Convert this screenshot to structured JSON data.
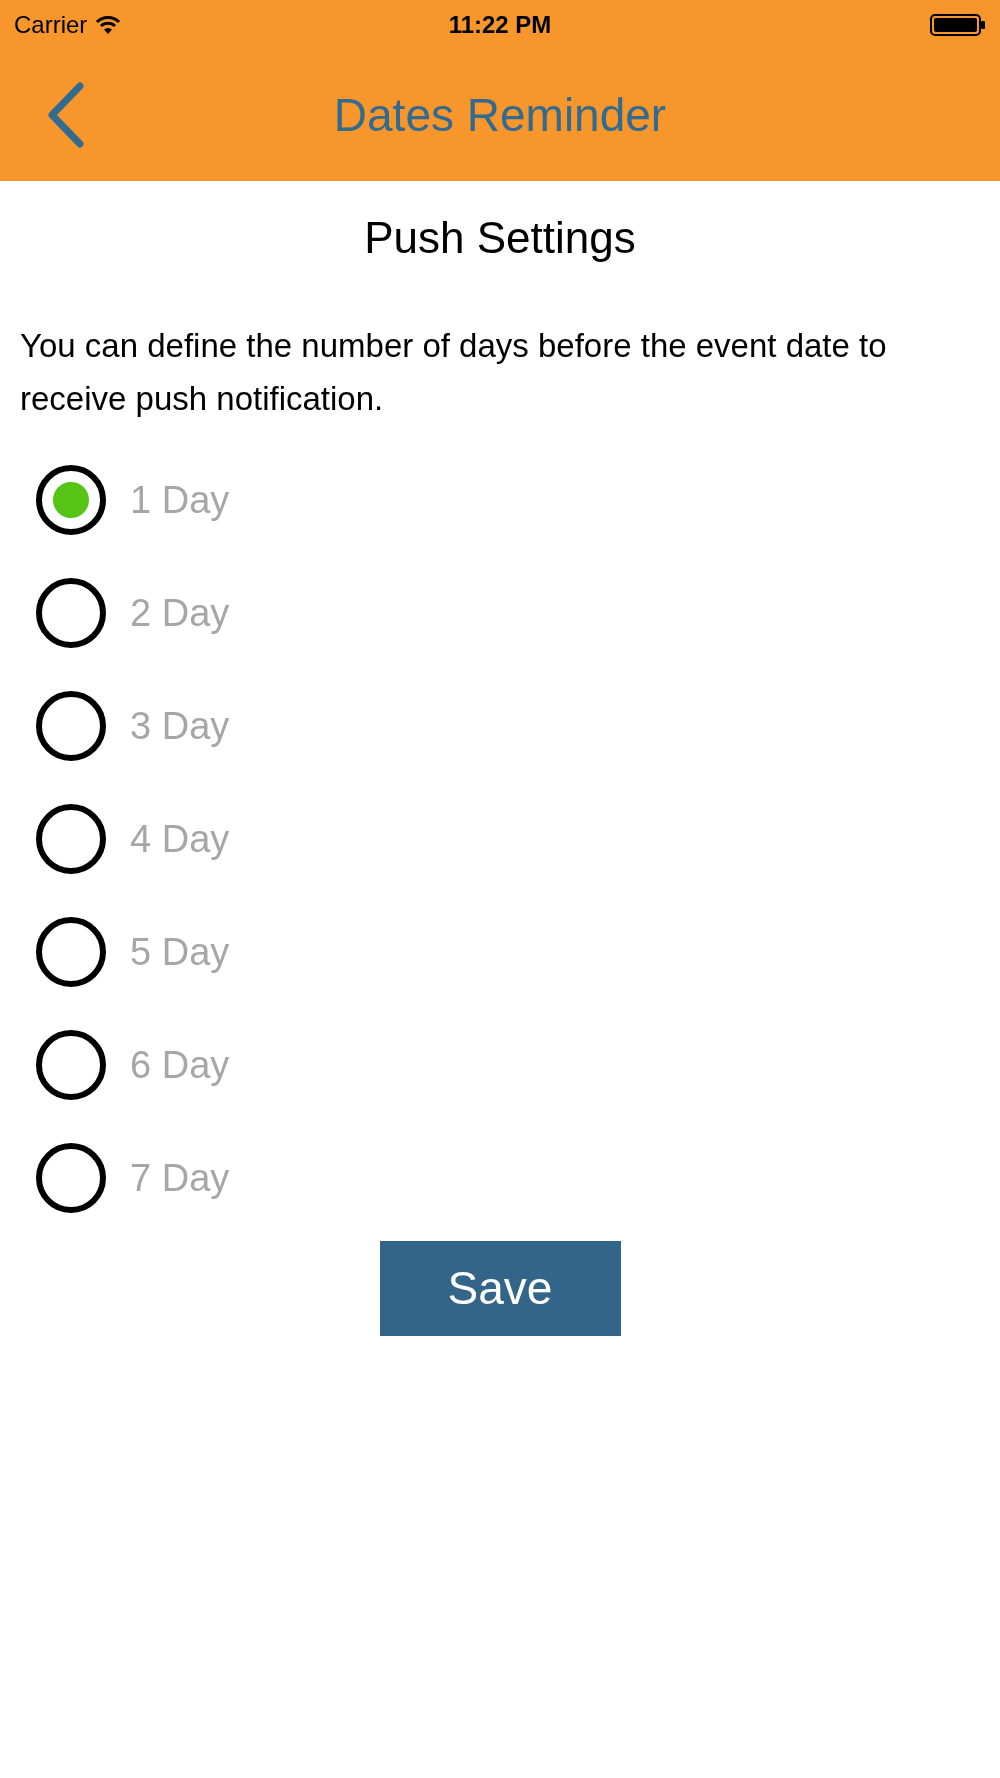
{
  "status_bar": {
    "carrier": "Carrier",
    "time": "11:22 PM"
  },
  "nav_bar": {
    "title": "Dates Reminder"
  },
  "heading": "Push Settings",
  "description": "You can define the number of days before the event date to receive push notification.",
  "options": [
    {
      "label": "1 Day",
      "selected": true
    },
    {
      "label": "2 Day",
      "selected": false
    },
    {
      "label": "3 Day",
      "selected": false
    },
    {
      "label": "4 Day",
      "selected": false
    },
    {
      "label": "5 Day",
      "selected": false
    },
    {
      "label": "6 Day",
      "selected": false
    },
    {
      "label": "7 Day",
      "selected": false
    }
  ],
  "save_button": "Save"
}
